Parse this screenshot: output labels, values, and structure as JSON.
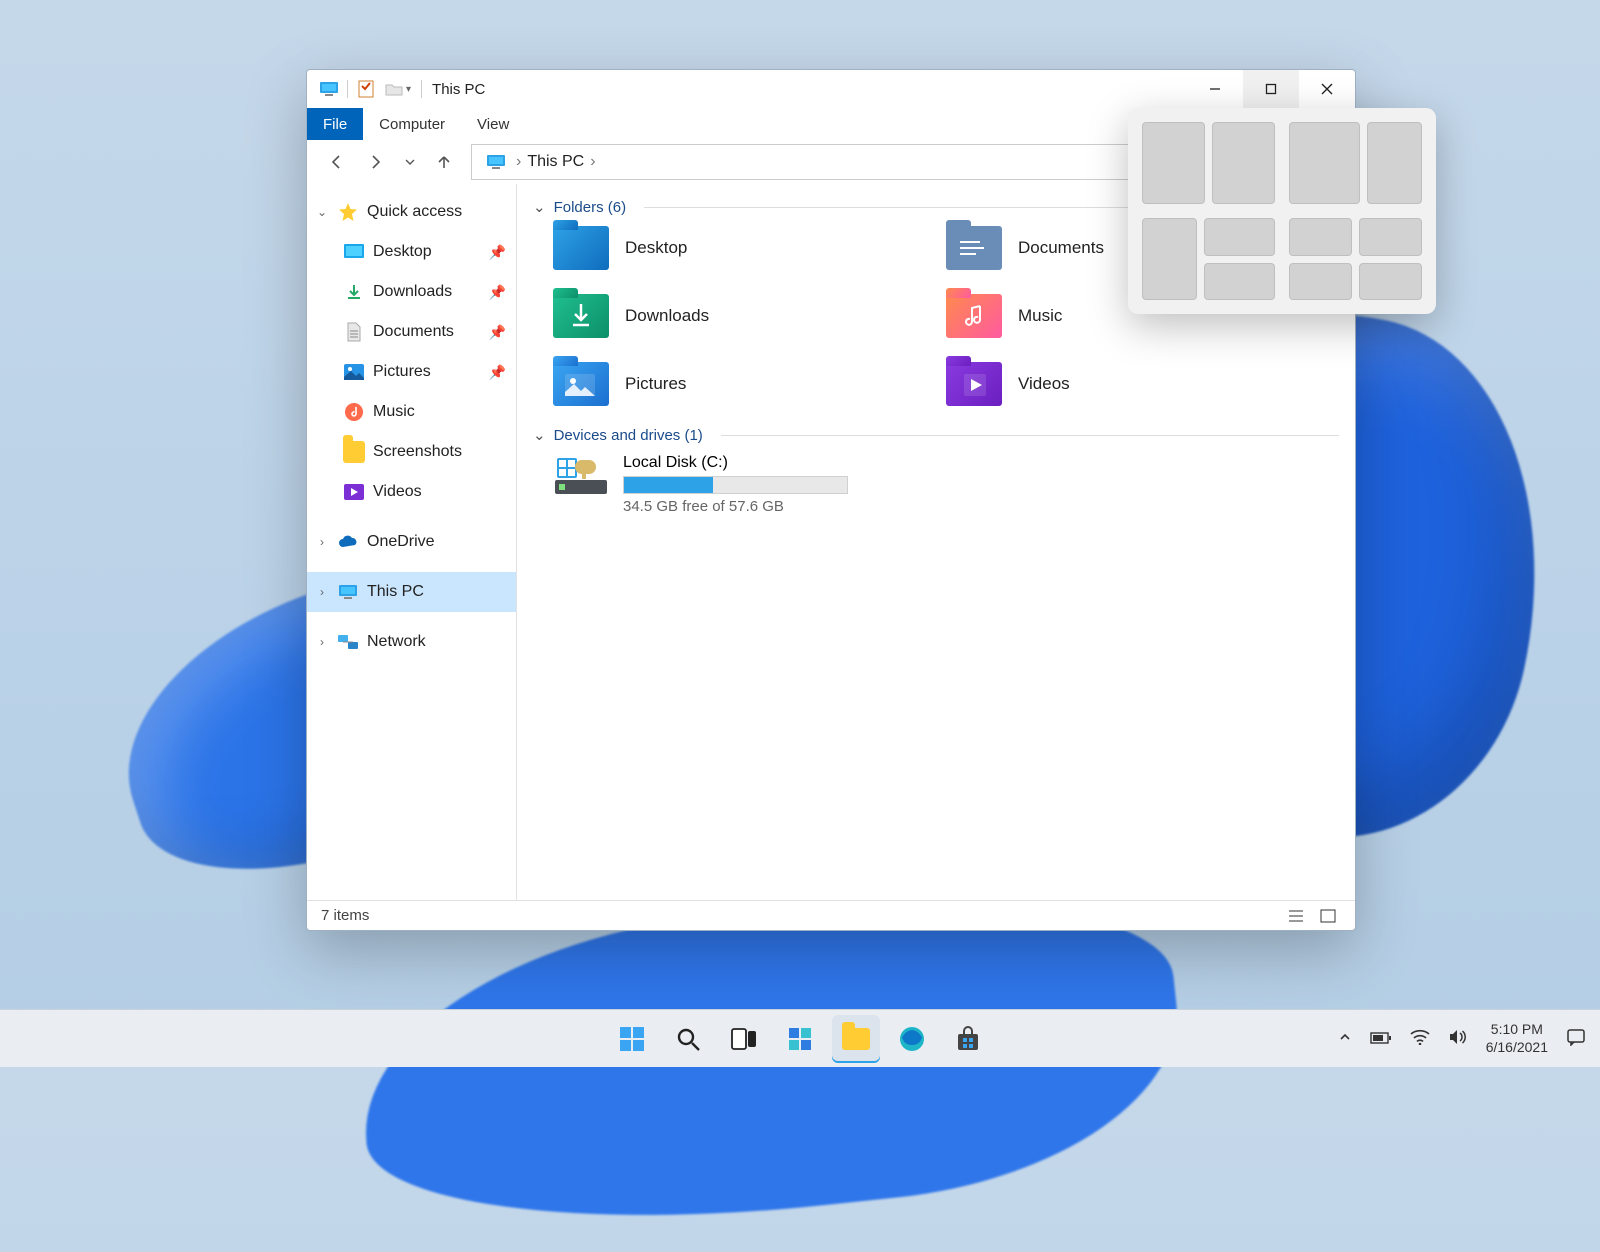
{
  "titlebar": {
    "window_title": "This PC"
  },
  "ribbon": {
    "tabs": [
      "File",
      "Computer",
      "View"
    ],
    "active": 0
  },
  "address": {
    "crumbs": [
      "This PC"
    ]
  },
  "nav": {
    "quick_access": "Quick access",
    "quick_items": [
      {
        "label": "Desktop",
        "pinned": true
      },
      {
        "label": "Downloads",
        "pinned": true
      },
      {
        "label": "Documents",
        "pinned": true
      },
      {
        "label": "Pictures",
        "pinned": true
      },
      {
        "label": "Music",
        "pinned": false
      },
      {
        "label": "Screenshots",
        "pinned": false
      },
      {
        "label": "Videos",
        "pinned": false
      }
    ],
    "roots": [
      {
        "label": "OneDrive"
      },
      {
        "label": "This PC",
        "selected": true
      },
      {
        "label": "Network"
      }
    ]
  },
  "content": {
    "folders_header": "Folders (6)",
    "folders": [
      "Desktop",
      "Documents",
      "Downloads",
      "Music",
      "Pictures",
      "Videos"
    ],
    "drives_header": "Devices and drives (1)",
    "drive": {
      "label": "Local Disk (C:)",
      "free_text": "34.5 GB free of 57.6 GB",
      "used_pct": 40
    }
  },
  "status": {
    "item_count": "7 items"
  },
  "taskbar": {
    "time": "5:10 PM",
    "date": "6/16/2021"
  }
}
